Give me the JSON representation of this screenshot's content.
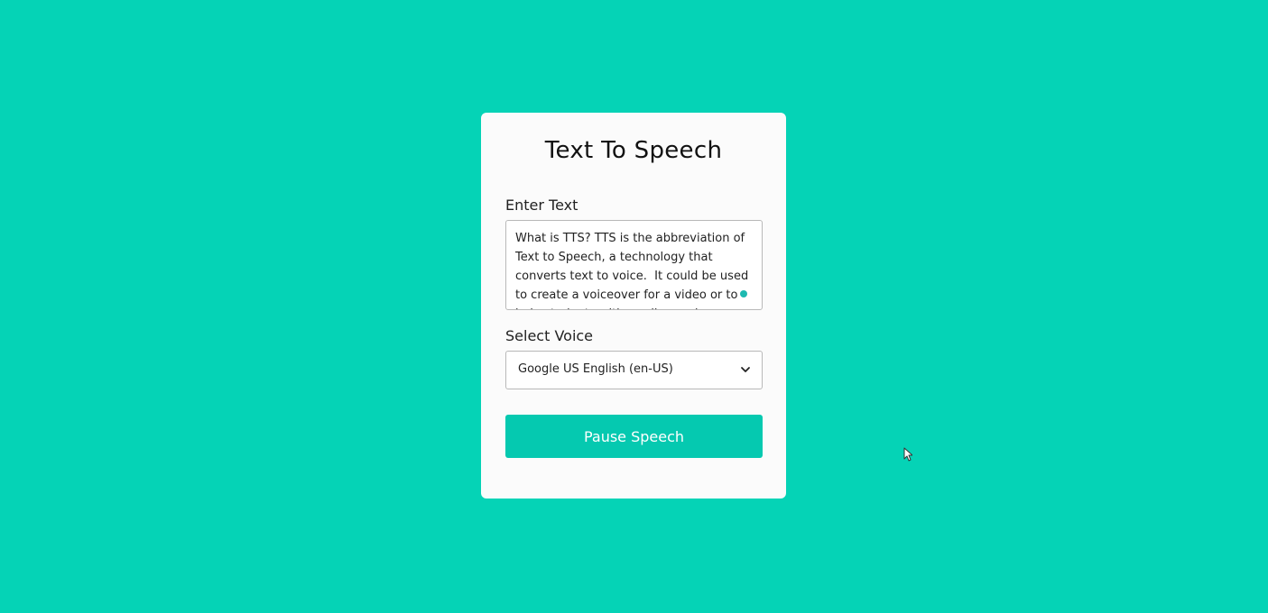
{
  "card": {
    "title": "Text To Speech",
    "text_label": "Enter Text",
    "text_value": "What is TTS? TTS is the abbreviation of Text to Speech, a technology that converts text to voice.  It could be used to create a voiceover for a video or to help students with reading and learning.",
    "voice_label": "Select Voice",
    "voice_selected": "Google US English (en-US)",
    "button_label": "Pause Speech"
  },
  "colors": {
    "background": "#05d3b6",
    "button": "#05c9b0",
    "card": "#fbfbfb"
  },
  "icons": {
    "select_arrow": "chevron-down-icon",
    "pointer": "mouse-cursor-icon"
  }
}
